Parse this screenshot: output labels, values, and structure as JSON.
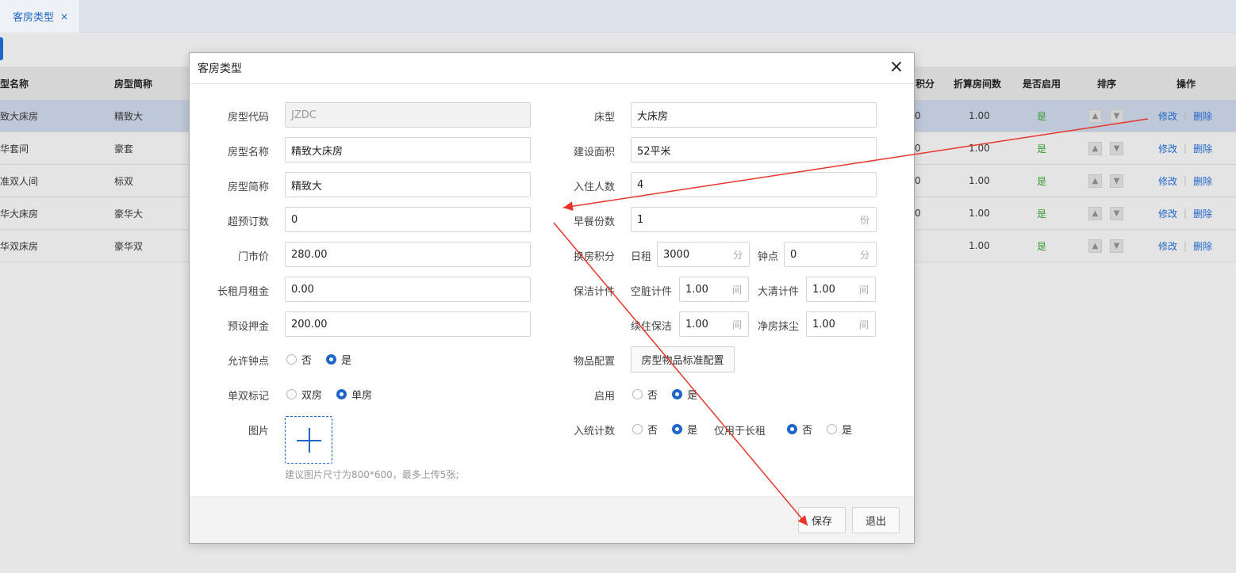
{
  "tabbar": {
    "tab_label": "客房类型",
    "close_glyph": "×"
  },
  "table": {
    "headers": {
      "type_name": "型名称",
      "short_name": "房型简称",
      "points": "积分",
      "converted": "折算房间数",
      "enabled": "是否启用",
      "sort": "排序",
      "ops": "操作"
    },
    "rows": [
      {
        "type_name": "致大床房",
        "short_name": "精致大",
        "points_tail": "0",
        "converted": "1.00",
        "enabled": "是",
        "edit": "修改",
        "del": "删除"
      },
      {
        "type_name": "华套间",
        "short_name": "豪套",
        "points_tail": "0",
        "converted": "1.00",
        "enabled": "是",
        "edit": "修改",
        "del": "删除"
      },
      {
        "type_name": "准双人间",
        "short_name": "标双",
        "points_tail": "0",
        "converted": "1.00",
        "enabled": "是",
        "edit": "修改",
        "del": "删除"
      },
      {
        "type_name": "华大床房",
        "short_name": "豪华大",
        "points_tail": "0",
        "converted": "1.00",
        "enabled": "是",
        "edit": "修改",
        "del": "删除"
      },
      {
        "type_name": "华双床房",
        "short_name": "豪华双",
        "points_tail": "",
        "converted": "1.00",
        "enabled": "是",
        "edit": "修改",
        "del": "删除"
      }
    ]
  },
  "dialog": {
    "title": "客房类型",
    "close_glyph": "×",
    "left": {
      "code_label": "房型代码",
      "code_value": "JZDC",
      "name_label": "房型名称",
      "name_value": "精致大床房",
      "short_label": "房型简称",
      "short_value": "精致大",
      "overbook_label": "超预订数",
      "overbook_value": "0",
      "rack_label": "门市价",
      "rack_value": "280.00",
      "longrent_label": "长租月租金",
      "longrent_value": "0.00",
      "deposit_label": "预设押金",
      "deposit_value": "200.00",
      "hourly_label": "允许钟点",
      "hourly_no": "否",
      "hourly_yes": "是",
      "single_label": "单双标记",
      "single_double": "双房",
      "single_single": "单房",
      "image_label": "图片",
      "image_hint": "建议图片尺寸为800*600，最多上传5张;"
    },
    "right": {
      "bed_label": "床型",
      "bed_value": "大床房",
      "area_label": "建设面积",
      "area_value": "52平米",
      "occupancy_label": "入住人数",
      "occupancy_value": "4",
      "breakfast_label": "早餐份数",
      "breakfast_value": "1",
      "breakfast_unit": "份",
      "swap_label": "换房积分",
      "day_label": "日租",
      "day_value": "3000",
      "day_unit": "分",
      "hour_label": "钟点",
      "hour_value": "0",
      "hour_unit": "分",
      "clean_label": "保洁计件",
      "dirty_label": "空脏计件",
      "dirty_value": "1.00",
      "dirty_unit": "间",
      "deep_label": "大清计件",
      "deep_value": "1.00",
      "deep_unit": "间",
      "stay_label": "续住保洁",
      "stay_value": "1.00",
      "stay_unit": "间",
      "dust_label": "净房抹尘",
      "dust_value": "1.00",
      "dust_unit": "间",
      "items_label": "物品配置",
      "items_button": "房型物品标准配置",
      "enable_label": "启用",
      "enable_no": "否",
      "enable_yes": "是",
      "stats_label": "入统计数",
      "stats_no": "否",
      "stats_yes": "是",
      "longonly_label": "仅用于长租",
      "longonly_no": "否",
      "longonly_yes": "是"
    },
    "footer": {
      "save": "保存",
      "exit": "退出"
    }
  },
  "colors": {
    "accent": "#1f66c9",
    "annotation": "#e8362b",
    "yes_green": "#2f9b2f"
  }
}
